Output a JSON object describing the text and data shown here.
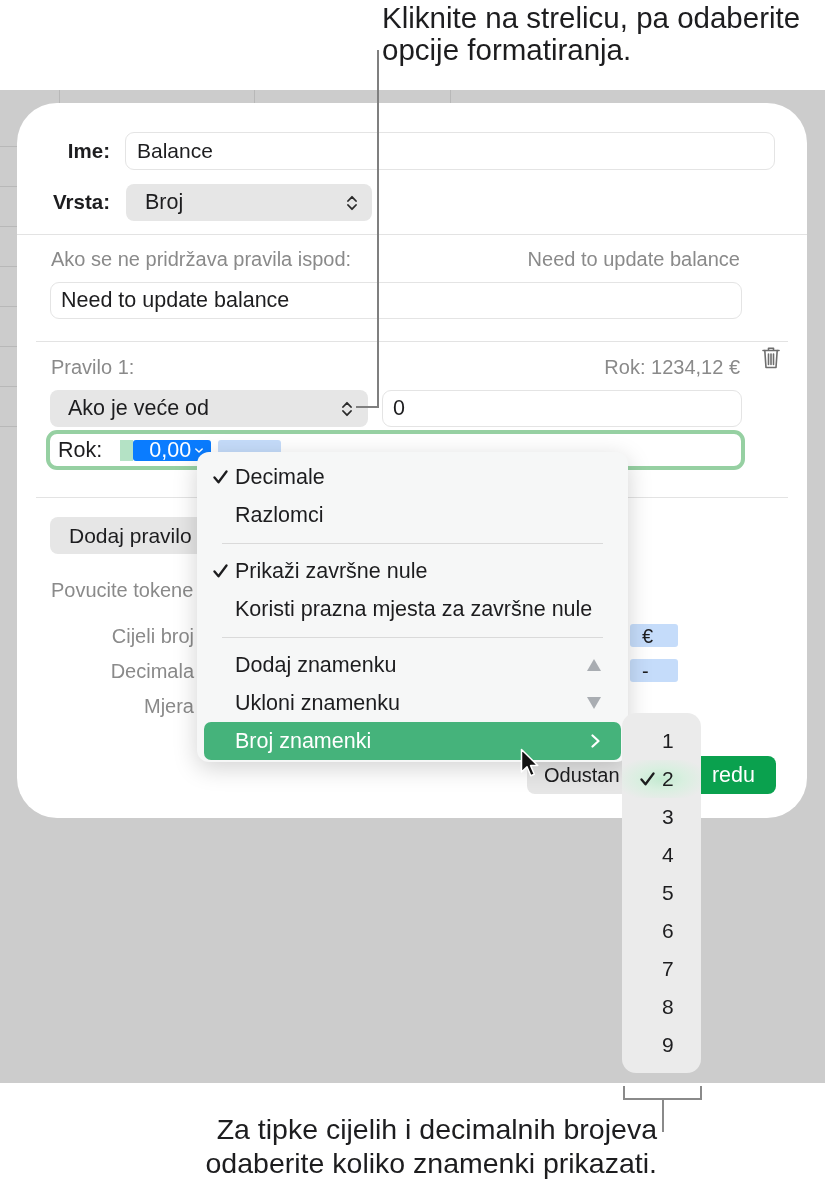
{
  "callout_top": {
    "lines": [
      "Kliknite na strelicu, pa odaberite",
      "opcije formatiranja."
    ]
  },
  "dialog": {
    "name_field": {
      "label": "Ime:",
      "value": "Balance"
    },
    "type_popup": {
      "label": "Vrsta:",
      "value": "Broj"
    },
    "fallback": {
      "label": "Ako se ne pridržava pravila ispod:",
      "preview": "Need to update balance",
      "value": "Need to update balance"
    },
    "rule": {
      "label": "Pravilo 1:",
      "preview": "Rok: 1234,12 €",
      "condition": "Ako je veće od",
      "value": "0",
      "format_field": {
        "label": "Rok:",
        "tokens": [
          {
            "text": "0,00",
            "selected": true
          },
          {
            "selected": false
          }
        ]
      }
    },
    "add_rule_button": "Dodaj pravilo",
    "tokens_hint": "Povucite tokene",
    "token_rows": [
      {
        "label": "Cijeli broj",
        "token": "€"
      },
      {
        "label": "Decimala",
        "token": "-"
      },
      {
        "label": "Mjera"
      }
    ],
    "buttons": [
      {
        "label": "Odustan",
        "kind": "secondary"
      },
      {
        "label": "redu",
        "kind": "primary"
      }
    ]
  },
  "menu": {
    "groups": [
      [
        {
          "label": "Decimale",
          "kind": "plain",
          "checked": true,
          "selected": false
        },
        {
          "label": "Razlomci",
          "kind": "plain",
          "checked": false,
          "selected": false
        }
      ],
      [
        {
          "label": "Prikaži završne nule",
          "kind": "plain",
          "checked": true,
          "selected": false
        },
        {
          "label": "Koristi prazna mjesta za završne nule",
          "kind": "plain",
          "checked": false,
          "selected": false
        }
      ],
      [
        {
          "label": "Dodaj znamenku",
          "kind": "increase",
          "checked": false,
          "selected": false
        },
        {
          "label": "Ukloni znamenku",
          "kind": "decrease",
          "checked": false,
          "selected": false
        },
        {
          "label": "Broj znamenki",
          "kind": "submenu",
          "checked": false,
          "selected": true
        }
      ]
    ]
  },
  "submenu": {
    "items": [
      {
        "label": "1",
        "checked": false
      },
      {
        "label": "2",
        "checked": true
      },
      {
        "label": "3",
        "checked": false
      },
      {
        "label": "4",
        "checked": false
      },
      {
        "label": "5",
        "checked": false
      },
      {
        "label": "6",
        "checked": false
      },
      {
        "label": "7",
        "checked": false
      },
      {
        "label": "8",
        "checked": false
      },
      {
        "label": "9",
        "checked": false
      }
    ]
  },
  "callout_bottom": {
    "lines": [
      "Za tipke cijelih i decimalnih brojeva",
      "odaberite koliko znamenki prikazati."
    ]
  }
}
